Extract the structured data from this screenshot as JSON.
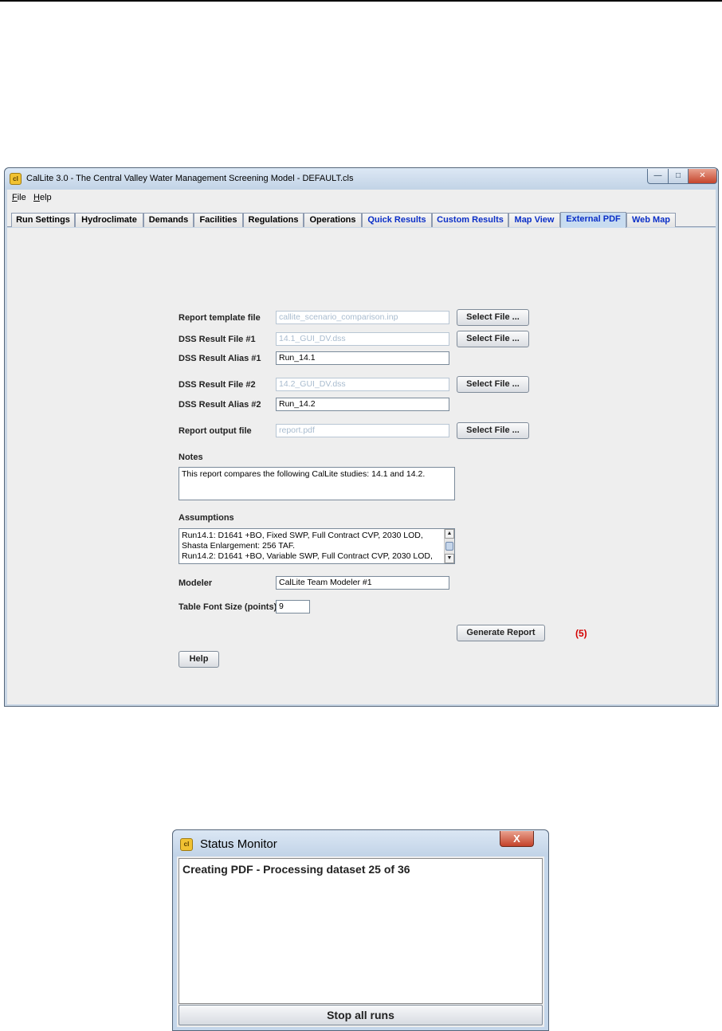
{
  "main_window": {
    "title": "CalLite 3.0 -  The Central Valley Water Management Screening Model - DEFAULT.cls",
    "app_icon_glyph": "cl",
    "controls": {
      "minimize": "—",
      "maximize": "□",
      "close": "✕"
    },
    "menu": {
      "file": {
        "underlined": "F",
        "rest": "ile"
      },
      "help": {
        "underlined": "H",
        "rest": "elp"
      }
    },
    "tabs": [
      {
        "label": "Run Settings",
        "color": "#000000"
      },
      {
        "label": "Hydroclimate",
        "color": "#000000"
      },
      {
        "label": "Demands",
        "color": "#000000"
      },
      {
        "label": "Facilities",
        "color": "#000000"
      },
      {
        "label": "Regulations",
        "color": "#000000"
      },
      {
        "label": "Operations",
        "color": "#000000"
      },
      {
        "label": "Quick Results",
        "color": "#0b2fc7"
      },
      {
        "label": "Custom Results",
        "color": "#0b2fc7"
      },
      {
        "label": "Map View",
        "color": "#0b2fc7"
      },
      {
        "label": "External PDF",
        "color": "#0b2fc7",
        "selected": true
      },
      {
        "label": "Web Map",
        "color": "#0b2fc7"
      }
    ],
    "form": {
      "report_template": {
        "label": "Report template file",
        "value": "callite_scenario_comparison.inp",
        "button": "Select File ..."
      },
      "dss_file_1": {
        "label": "DSS Result File #1",
        "value": "14.1_GUI_DV.dss",
        "button": "Select File ..."
      },
      "dss_alias_1": {
        "label": "DSS Result Alias #1",
        "value": "Run_14.1"
      },
      "dss_file_2": {
        "label": "DSS Result File #2",
        "value": "14.2_GUI_DV.dss",
        "button": "Select File ..."
      },
      "dss_alias_2": {
        "label": "DSS Result Alias #2",
        "value": "Run_14.2"
      },
      "output_file": {
        "label": "Report output file",
        "value": "report.pdf",
        "button": "Select File ..."
      },
      "notes": {
        "label": "Notes",
        "value": "This report compares the following CalLite studies: 14.1 and 14.2."
      },
      "assumptions": {
        "label": "Assumptions",
        "lines": [
          "Run14.1: D1641 +BO, Fixed SWP, Full Contract CVP, 2030 LOD,",
          "Shasta Enlargement: 256 TAF.",
          "Run14.2: D1641 +BO, Variable SWP, Full Contract CVP, 2030 LOD,"
        ]
      },
      "modeler": {
        "label": "Modeler",
        "value": "CalLite Team Modeler #1"
      },
      "table_font_size": {
        "label": "Table Font Size (points)",
        "value": "9"
      },
      "generate_button": "Generate Report",
      "step_marker": "(5)",
      "help_button": "Help"
    }
  },
  "status_monitor": {
    "title": "Status Monitor",
    "icon_glyph": "cl",
    "close_glyph": "X",
    "message": "Creating PDF - Processing dataset 25 of 36",
    "stop_button": "Stop all runs"
  },
  "colors": {
    "window_frame": "#c9d7e6",
    "tab_link": "#0b2fc7",
    "step_marker": "#d40000",
    "close_button": "#c5442b"
  }
}
